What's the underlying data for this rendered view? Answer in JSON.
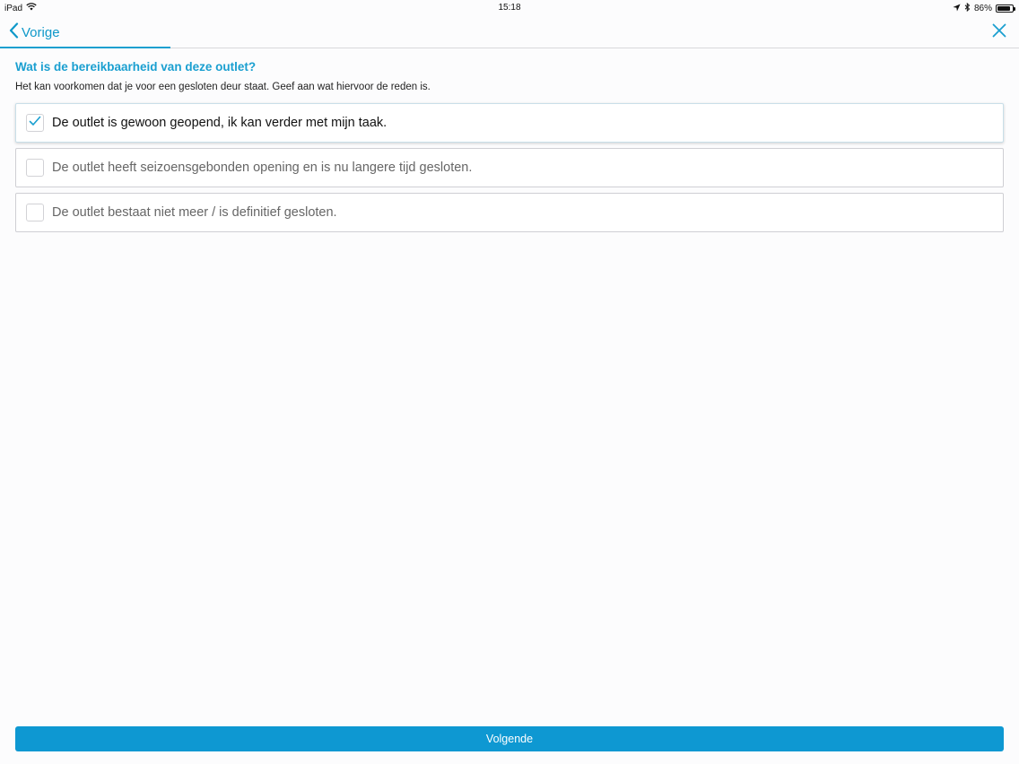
{
  "status_bar": {
    "device": "iPad",
    "time": "15:18",
    "battery_percent": "86%",
    "battery_level": 0.86
  },
  "nav": {
    "back_label": "Vorige",
    "progress_fraction": 0.167
  },
  "question": {
    "title": "Wat is de bereikbaarheid van deze outlet?",
    "subtitle": "Het kan voorkomen dat je voor een gesloten deur staat. Geef aan wat hiervoor de reden is."
  },
  "options": [
    {
      "label": "De outlet is gewoon geopend, ik kan verder met mijn taak.",
      "checked": true
    },
    {
      "label": "De outlet heeft seizoensgebonden opening en is nu langere tijd gesloten.",
      "checked": false
    },
    {
      "label": "De outlet bestaat niet meer / is definitief gesloten.",
      "checked": false
    }
  ],
  "footer": {
    "next_label": "Volgende"
  },
  "colors": {
    "accent": "#1a9fd0",
    "button": "#0e98d2"
  },
  "icons": {
    "wifi": "wifi-icon",
    "location": "location-arrow-icon",
    "bluetooth": "bluetooth-icon",
    "battery": "battery-icon",
    "back": "chevron-left-icon",
    "close": "close-icon",
    "check": "checkmark-icon"
  }
}
